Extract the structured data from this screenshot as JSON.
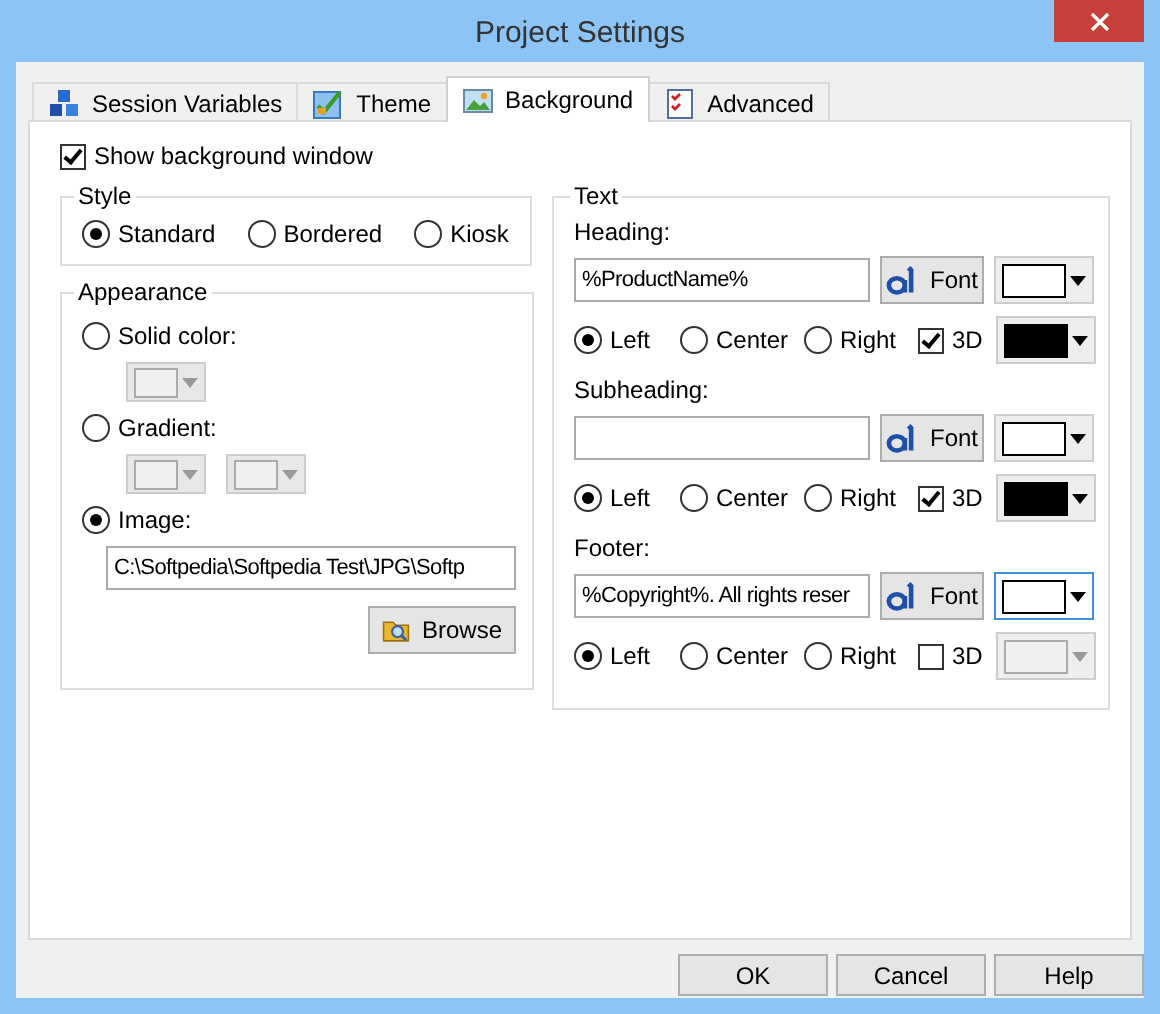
{
  "window": {
    "title": "Project Settings"
  },
  "tabs": [
    {
      "label": "Session Variables",
      "selected": false
    },
    {
      "label": "Theme",
      "selected": false
    },
    {
      "label": "Background",
      "selected": true
    },
    {
      "label": "Advanced",
      "selected": false
    }
  ],
  "show_background": {
    "label": "Show background window",
    "checked": true
  },
  "style": {
    "title": "Style",
    "options": [
      {
        "label": "Standard",
        "selected": true
      },
      {
        "label": "Bordered",
        "selected": false
      },
      {
        "label": "Kiosk",
        "selected": false
      }
    ]
  },
  "appearance": {
    "title": "Appearance",
    "options": [
      {
        "kind": "color",
        "label": "Solid color:",
        "selected": false,
        "pickers": [
          {
            "enabled": false
          }
        ]
      },
      {
        "kind": "color",
        "label": "Gradient:",
        "selected": false,
        "pickers": [
          {
            "enabled": false
          },
          {
            "enabled": false
          }
        ]
      },
      {
        "kind": "image",
        "label": "Image:",
        "selected": true,
        "value": "C:\\Softpedia\\Softpedia Test\\JPG\\Softp",
        "button": "Browse"
      }
    ]
  },
  "text": {
    "title": "Text",
    "sections": [
      {
        "label": "Heading:",
        "value": "%ProductName%",
        "font_button": "Font",
        "text_picker": {
          "color": "#ffffff",
          "focused": false
        },
        "align": [
          {
            "label": "Left",
            "selected": true
          },
          {
            "label": "Center",
            "selected": false
          },
          {
            "label": "Right",
            "selected": false
          }
        ],
        "three_d": {
          "label": "3D",
          "checked": true
        },
        "shadow_picker": {
          "color": "#000000",
          "enabled": true
        }
      },
      {
        "label": "Subheading:",
        "font_button": "Font",
        "text_picker": {
          "color": "#ffffff",
          "focused": false
        },
        "align": [
          {
            "label": "Left",
            "selected": true
          },
          {
            "label": "Center",
            "selected": false
          },
          {
            "label": "Right",
            "selected": false
          }
        ],
        "three_d": {
          "label": "3D",
          "checked": true
        },
        "shadow_picker": {
          "color": "#000000",
          "enabled": true
        }
      },
      {
        "label": "Footer:",
        "value": "%Copyright%. All rights reser",
        "font_button": "Font",
        "text_picker": {
          "color": "#ffffff",
          "focused": true
        },
        "align": [
          {
            "label": "Left",
            "selected": true
          },
          {
            "label": "Center",
            "selected": false
          },
          {
            "label": "Right",
            "selected": false
          }
        ],
        "three_d": {
          "label": "3D",
          "checked": false
        },
        "shadow_picker": {
          "enabled": false
        }
      }
    ]
  },
  "buttons": [
    "OK",
    "Cancel",
    "Help"
  ]
}
